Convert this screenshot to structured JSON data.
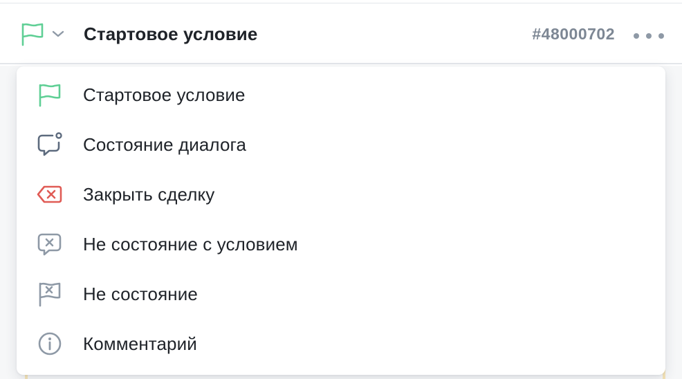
{
  "header": {
    "title": "Стартовое условие",
    "id": "#48000702"
  },
  "menu": {
    "items": [
      {
        "label": "Стартовое условие",
        "icon": "flag-icon",
        "color": "#5fcf95"
      },
      {
        "label": "Состояние диалога",
        "icon": "chat-bubble-dot-icon",
        "color": "#5d6b7e"
      },
      {
        "label": "Закрыть сделку",
        "icon": "close-deal-icon",
        "color": "#e05b55"
      },
      {
        "label": "Не состояние с условием",
        "icon": "chat-bubble-x-icon",
        "color": "#8e99a6"
      },
      {
        "label": "Не состояние",
        "icon": "flag-x-icon",
        "color": "#8e99a6"
      },
      {
        "label": "Комментарий",
        "icon": "info-icon",
        "color": "#8e99a6"
      }
    ]
  },
  "colors": {
    "accent_green": "#5fcf95",
    "muted_gray": "#8e99a6",
    "danger_red": "#e05b55",
    "text": "#1f2329"
  }
}
